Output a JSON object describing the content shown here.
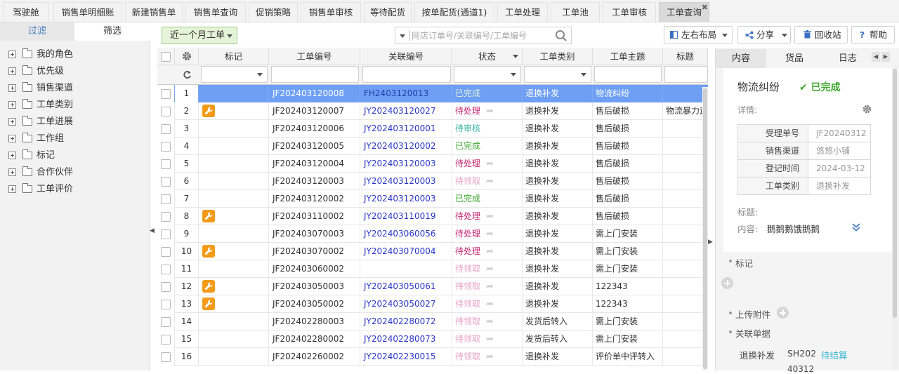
{
  "tabs": [
    {
      "label": "驾驶舱"
    },
    {
      "label": "销售单明细账"
    },
    {
      "label": "新建销售单"
    },
    {
      "label": "销售单查询"
    },
    {
      "label": "促销策略"
    },
    {
      "label": "销售单审核"
    },
    {
      "label": "等待配货"
    },
    {
      "label": "按单配货(通道1)"
    },
    {
      "label": "工单处理"
    },
    {
      "label": "工单池"
    },
    {
      "label": "工单审核"
    },
    {
      "label": "工单查询"
    }
  ],
  "sidebar": {
    "tab_filter": "过滤",
    "tab_screen": "筛选",
    "items": [
      {
        "label": "我的角色"
      },
      {
        "label": "优先级"
      },
      {
        "label": "销售渠道"
      },
      {
        "label": "工单类别"
      },
      {
        "label": "工单进展"
      },
      {
        "label": "工作组"
      },
      {
        "label": "标记"
      },
      {
        "label": "合作伙伴"
      },
      {
        "label": "工单评价"
      }
    ]
  },
  "toolbar": {
    "period": "近一个月工单",
    "search_placeholder": "网店订单号/关联编号/工单编号",
    "layout": "左右布局",
    "share": "分享",
    "recycle": "回收站",
    "help": "帮助"
  },
  "columns": {
    "mark": "标记",
    "no": "工单编号",
    "rel": "关联编号",
    "status": "状态",
    "type": "工单类别",
    "topic": "工单主题",
    "title": "标题"
  },
  "rows": [
    {
      "i": "1",
      "no": "JF202403120008",
      "rel": "FH2403120013",
      "status": "已完成",
      "type": "退换补发",
      "topic": "物流纠纷",
      "title": "",
      "w": false,
      "s": "green"
    },
    {
      "i": "2",
      "no": "JF202403120007",
      "rel": "JY202403120027",
      "status": "待处理",
      "type": "退换补发",
      "topic": "售后破损",
      "title": "物流暴力运",
      "w": true,
      "s": "red"
    },
    {
      "i": "3",
      "no": "JF202403120006",
      "rel": "JY202403120001",
      "status": "待审核",
      "type": "退换补发",
      "topic": "售后破损",
      "title": "",
      "w": false,
      "s": "teal"
    },
    {
      "i": "4",
      "no": "JF202403120005",
      "rel": "JY202403120002",
      "status": "已完成",
      "type": "退换补发",
      "topic": "售后破损",
      "title": "",
      "w": false,
      "s": "green"
    },
    {
      "i": "5",
      "no": "JF202403120004",
      "rel": "JY202403120003",
      "status": "待处理",
      "type": "退换补发",
      "topic": "售后破损",
      "title": "",
      "w": false,
      "s": "red"
    },
    {
      "i": "6",
      "no": "JF202403120003",
      "rel": "JY202403120003",
      "status": "待领取",
      "type": "退换补发",
      "topic": "售后破损",
      "title": "",
      "w": false,
      "s": "pink"
    },
    {
      "i": "7",
      "no": "JF202403120002",
      "rel": "JY202403120003",
      "status": "已完成",
      "type": "退换补发",
      "topic": "售后破损",
      "title": "",
      "w": false,
      "s": "green"
    },
    {
      "i": "8",
      "no": "JF202403110002",
      "rel": "JY202403110019",
      "status": "待处理",
      "type": "退换补发",
      "topic": "售后破损",
      "title": "",
      "w": true,
      "s": "red"
    },
    {
      "i": "9",
      "no": "JF202403070003",
      "rel": "JY202403060056",
      "status": "待处理",
      "type": "退换补发",
      "topic": "需上门安装",
      "title": "",
      "w": false,
      "s": "red"
    },
    {
      "i": "10",
      "no": "JF202403070002",
      "rel": "JY202403070004",
      "status": "待处理",
      "type": "退换补发",
      "topic": "需上门安装",
      "title": "",
      "w": true,
      "s": "red"
    },
    {
      "i": "11",
      "no": "JF202403060002",
      "rel": "",
      "status": "待领取",
      "type": "退换补发",
      "topic": "需上门安装",
      "title": "",
      "w": false,
      "s": "pink"
    },
    {
      "i": "12",
      "no": "JF202403050003",
      "rel": "JY202403050061",
      "status": "待领取",
      "type": "退换补发",
      "topic": "122343",
      "title": "",
      "w": true,
      "s": "pink"
    },
    {
      "i": "13",
      "no": "JF202403050002",
      "rel": "JY202403050027",
      "status": "待领取",
      "type": "退换补发",
      "topic": "122343",
      "title": "",
      "w": true,
      "s": "pink"
    },
    {
      "i": "14",
      "no": "JF202402280003",
      "rel": "JY202402280072",
      "status": "待领取",
      "type": "发货后转入",
      "topic": "需上门安装",
      "title": "",
      "w": false,
      "s": "pink"
    },
    {
      "i": "15",
      "no": "JF202402280002",
      "rel": "JY202402280073",
      "status": "待领取",
      "type": "发货后转入",
      "topic": "需上门安装",
      "title": "",
      "w": false,
      "s": "pink"
    },
    {
      "i": "16",
      "no": "JF202402260002",
      "rel": "JY202402230015",
      "status": "待领取",
      "type": "退换补发",
      "topic": "评价单中评转入",
      "title": "",
      "w": false,
      "s": "pink"
    }
  ],
  "detail": {
    "tabs": [
      "内容",
      "货品",
      "日志"
    ],
    "title": "物流纠纷",
    "status": "已完成",
    "details_label": "详情:",
    "kv": [
      {
        "k": "受理单号",
        "v": "JF20240312"
      },
      {
        "k": "销售渠道",
        "v": "悠悠小铺"
      },
      {
        "k": "登记时间",
        "v": "2024-03-12"
      },
      {
        "k": "工单类别",
        "v": "退换补发"
      }
    ],
    "title_label": "标题:",
    "content_label": "内容:",
    "content_value": "鹅鹅鹅饿鹅鹅",
    "mark_label": "标记",
    "upload_label": "上传附件",
    "linked_label": "关联单据",
    "linked_type": "退换补发",
    "linked_no": "SH202",
    "linked_status": "待结算",
    "linked_no2": "40312"
  },
  "colors": {
    "selected_row": "#6e9ff5",
    "ok": "#3fa72f",
    "pending": "#c72772",
    "review": "#3ab5a2",
    "claim": "#e9a1c0",
    "link": "#2a37c7"
  }
}
